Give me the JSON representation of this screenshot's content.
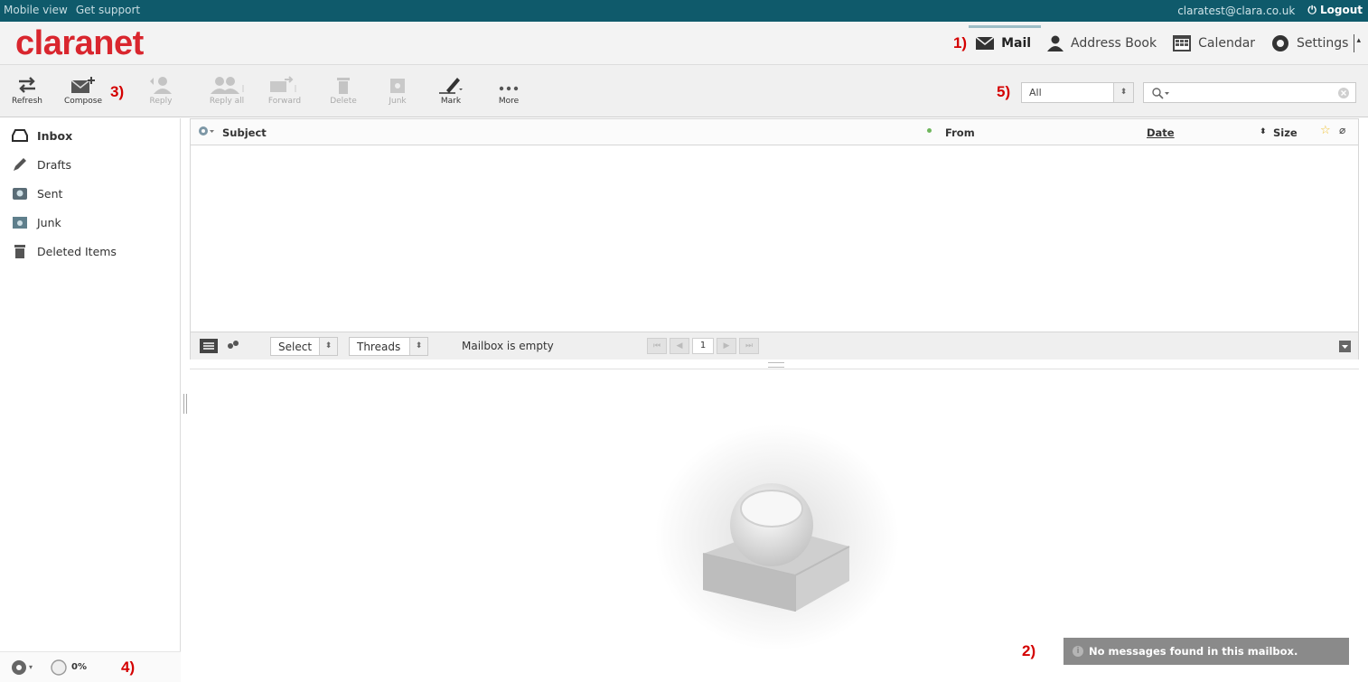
{
  "topbar": {
    "mobile_view": "Mobile view",
    "get_support": "Get support",
    "user_email": "claratest@clara.co.uk",
    "logout": "Logout"
  },
  "header": {
    "logo": "claranet",
    "nav": [
      {
        "label": "Mail",
        "icon": "envelope-icon",
        "active": true
      },
      {
        "label": "Address Book",
        "icon": "person-icon"
      },
      {
        "label": "Calendar",
        "icon": "calendar-icon"
      },
      {
        "label": "Settings",
        "icon": "gear-icon"
      }
    ]
  },
  "annotations": {
    "a1": "1)",
    "a2": "2)",
    "a3": "3)",
    "a4": "4)",
    "a5": "5)"
  },
  "toolbar": {
    "refresh": "Refresh",
    "compose": "Compose",
    "reply": "Reply",
    "reply_all": "Reply all",
    "forward": "Forward",
    "delete": "Delete",
    "junk": "Junk",
    "mark": "Mark",
    "more": "More",
    "filter_value": "All"
  },
  "folders": [
    {
      "label": "Inbox",
      "icon": "inbox-icon",
      "active": true
    },
    {
      "label": "Drafts",
      "icon": "pencil-icon"
    },
    {
      "label": "Sent",
      "icon": "sent-icon"
    },
    {
      "label": "Junk",
      "icon": "junk-icon"
    },
    {
      "label": "Deleted Items",
      "icon": "trash-icon"
    }
  ],
  "quota": "0%",
  "list": {
    "columns": {
      "subject": "Subject",
      "from": "From",
      "date": "Date",
      "size": "Size"
    },
    "select_label": "Select",
    "threads_label": "Threads",
    "status": "Mailbox is empty",
    "page": "1"
  },
  "notice": "No messages found in this mailbox.",
  "colors": {
    "topbar": "#0f5a6b",
    "brand": "#d9262e",
    "annotation": "#d40000"
  }
}
